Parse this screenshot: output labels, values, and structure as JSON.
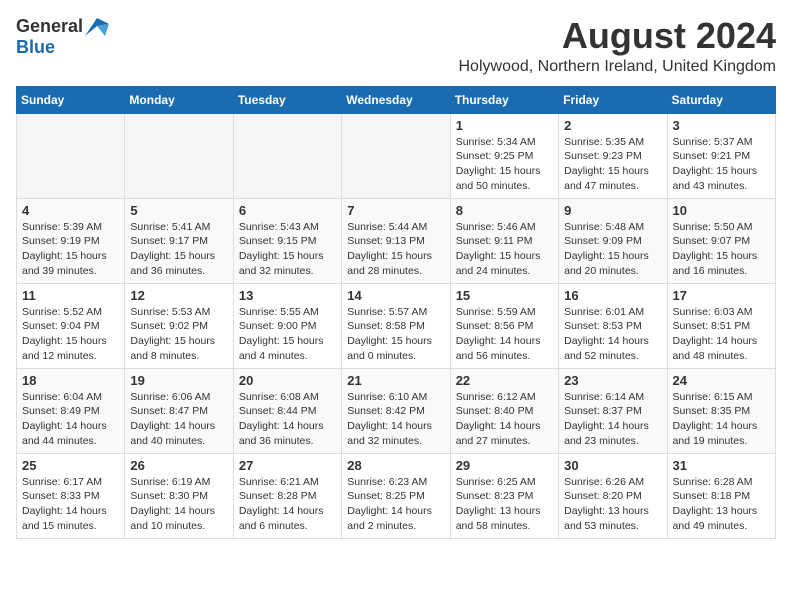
{
  "logo": {
    "general": "General",
    "blue": "Blue"
  },
  "title": "August 2024",
  "subtitle": "Holywood, Northern Ireland, United Kingdom",
  "days_of_week": [
    "Sunday",
    "Monday",
    "Tuesday",
    "Wednesday",
    "Thursday",
    "Friday",
    "Saturday"
  ],
  "weeks": [
    [
      {
        "day": "",
        "info": ""
      },
      {
        "day": "",
        "info": ""
      },
      {
        "day": "",
        "info": ""
      },
      {
        "day": "",
        "info": ""
      },
      {
        "day": "1",
        "info": "Sunrise: 5:34 AM\nSunset: 9:25 PM\nDaylight: 15 hours and 50 minutes."
      },
      {
        "day": "2",
        "info": "Sunrise: 5:35 AM\nSunset: 9:23 PM\nDaylight: 15 hours and 47 minutes."
      },
      {
        "day": "3",
        "info": "Sunrise: 5:37 AM\nSunset: 9:21 PM\nDaylight: 15 hours and 43 minutes."
      }
    ],
    [
      {
        "day": "4",
        "info": "Sunrise: 5:39 AM\nSunset: 9:19 PM\nDaylight: 15 hours and 39 minutes."
      },
      {
        "day": "5",
        "info": "Sunrise: 5:41 AM\nSunset: 9:17 PM\nDaylight: 15 hours and 36 minutes."
      },
      {
        "day": "6",
        "info": "Sunrise: 5:43 AM\nSunset: 9:15 PM\nDaylight: 15 hours and 32 minutes."
      },
      {
        "day": "7",
        "info": "Sunrise: 5:44 AM\nSunset: 9:13 PM\nDaylight: 15 hours and 28 minutes."
      },
      {
        "day": "8",
        "info": "Sunrise: 5:46 AM\nSunset: 9:11 PM\nDaylight: 15 hours and 24 minutes."
      },
      {
        "day": "9",
        "info": "Sunrise: 5:48 AM\nSunset: 9:09 PM\nDaylight: 15 hours and 20 minutes."
      },
      {
        "day": "10",
        "info": "Sunrise: 5:50 AM\nSunset: 9:07 PM\nDaylight: 15 hours and 16 minutes."
      }
    ],
    [
      {
        "day": "11",
        "info": "Sunrise: 5:52 AM\nSunset: 9:04 PM\nDaylight: 15 hours and 12 minutes."
      },
      {
        "day": "12",
        "info": "Sunrise: 5:53 AM\nSunset: 9:02 PM\nDaylight: 15 hours and 8 minutes."
      },
      {
        "day": "13",
        "info": "Sunrise: 5:55 AM\nSunset: 9:00 PM\nDaylight: 15 hours and 4 minutes."
      },
      {
        "day": "14",
        "info": "Sunrise: 5:57 AM\nSunset: 8:58 PM\nDaylight: 15 hours and 0 minutes."
      },
      {
        "day": "15",
        "info": "Sunrise: 5:59 AM\nSunset: 8:56 PM\nDaylight: 14 hours and 56 minutes."
      },
      {
        "day": "16",
        "info": "Sunrise: 6:01 AM\nSunset: 8:53 PM\nDaylight: 14 hours and 52 minutes."
      },
      {
        "day": "17",
        "info": "Sunrise: 6:03 AM\nSunset: 8:51 PM\nDaylight: 14 hours and 48 minutes."
      }
    ],
    [
      {
        "day": "18",
        "info": "Sunrise: 6:04 AM\nSunset: 8:49 PM\nDaylight: 14 hours and 44 minutes."
      },
      {
        "day": "19",
        "info": "Sunrise: 6:06 AM\nSunset: 8:47 PM\nDaylight: 14 hours and 40 minutes."
      },
      {
        "day": "20",
        "info": "Sunrise: 6:08 AM\nSunset: 8:44 PM\nDaylight: 14 hours and 36 minutes."
      },
      {
        "day": "21",
        "info": "Sunrise: 6:10 AM\nSunset: 8:42 PM\nDaylight: 14 hours and 32 minutes."
      },
      {
        "day": "22",
        "info": "Sunrise: 6:12 AM\nSunset: 8:40 PM\nDaylight: 14 hours and 27 minutes."
      },
      {
        "day": "23",
        "info": "Sunrise: 6:14 AM\nSunset: 8:37 PM\nDaylight: 14 hours and 23 minutes."
      },
      {
        "day": "24",
        "info": "Sunrise: 6:15 AM\nSunset: 8:35 PM\nDaylight: 14 hours and 19 minutes."
      }
    ],
    [
      {
        "day": "25",
        "info": "Sunrise: 6:17 AM\nSunset: 8:33 PM\nDaylight: 14 hours and 15 minutes."
      },
      {
        "day": "26",
        "info": "Sunrise: 6:19 AM\nSunset: 8:30 PM\nDaylight: 14 hours and 10 minutes."
      },
      {
        "day": "27",
        "info": "Sunrise: 6:21 AM\nSunset: 8:28 PM\nDaylight: 14 hours and 6 minutes."
      },
      {
        "day": "28",
        "info": "Sunrise: 6:23 AM\nSunset: 8:25 PM\nDaylight: 14 hours and 2 minutes."
      },
      {
        "day": "29",
        "info": "Sunrise: 6:25 AM\nSunset: 8:23 PM\nDaylight: 13 hours and 58 minutes."
      },
      {
        "day": "30",
        "info": "Sunrise: 6:26 AM\nSunset: 8:20 PM\nDaylight: 13 hours and 53 minutes."
      },
      {
        "day": "31",
        "info": "Sunrise: 6:28 AM\nSunset: 8:18 PM\nDaylight: 13 hours and 49 minutes."
      }
    ]
  ]
}
